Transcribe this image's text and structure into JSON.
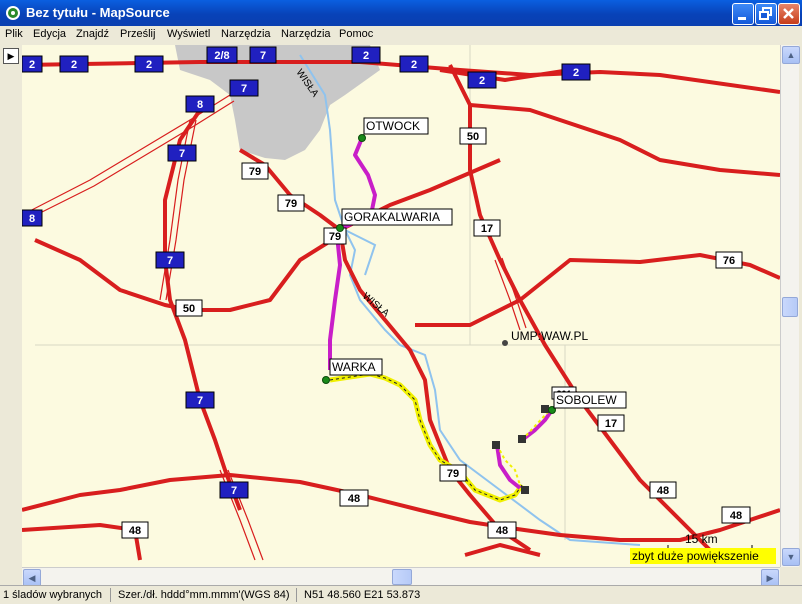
{
  "window": {
    "title": "Bez tytułu - MapSource"
  },
  "menu": [
    "Plik",
    "Edycja",
    "Znajdź",
    "Prześlij",
    "Wyświetl",
    "Narzędzia",
    "Narzędzia",
    "Pomoc"
  ],
  "map": {
    "places": [
      "OTWOCK",
      "GORAKALWARIA",
      "WARKA",
      "SOBOLEW",
      "UMP:WAW.PL"
    ],
    "rivers": [
      "WISŁA",
      "WISŁA"
    ],
    "shields_blue": [
      "2",
      "2",
      "2",
      "2/8",
      "7",
      "2",
      "2",
      "2",
      "2",
      "7",
      "8",
      "7",
      "8",
      "7",
      "7",
      "7"
    ],
    "shields_white": [
      "50",
      "79",
      "79",
      "79",
      "17",
      "76",
      "50",
      "79",
      "48",
      "48",
      "48",
      "17",
      "48",
      "48",
      "201"
    ],
    "scale": "15 km",
    "zoom_warning": "zbyt duże powiększenie"
  },
  "status": {
    "selection": "1 śladów wybranych",
    "format": "Szer./dł. hddd°mm.mmm'(WGS 84)",
    "coords": "N51 48.560 E21 53.873"
  },
  "colors": {
    "road": "#d81e1e",
    "track": "#c81ec8",
    "track_yellow": "#f0f000",
    "water": "#8fc3ee",
    "land": "#fcfae0",
    "urban": "#c8c8c8"
  }
}
